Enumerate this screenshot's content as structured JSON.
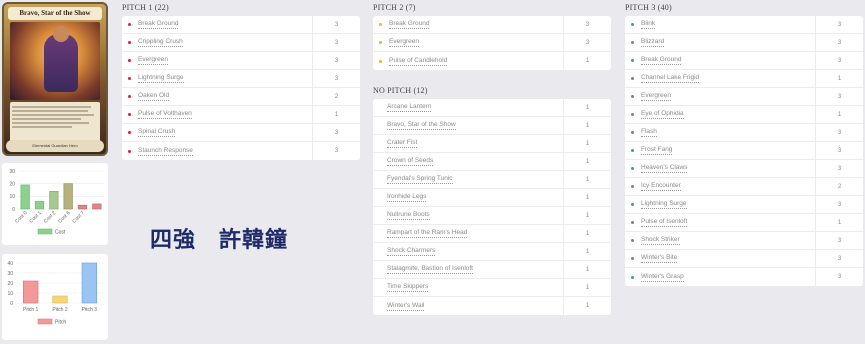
{
  "hero_card": {
    "name": "Bravo, Star of the Show",
    "type_line": "Elemental Guardian Hero",
    "intellect": "4",
    "life": "40"
  },
  "cost_chart_data": {
    "type": "bar",
    "categories": [
      "Cost 0",
      "Cost 1",
      "Cost 2",
      "Cost 6",
      "Cost 7"
    ],
    "values": [
      19,
      6,
      14,
      20,
      3
    ],
    "extra_value": 4,
    "yticks": [
      "0",
      "10",
      "20",
      "30"
    ],
    "ylim": [
      0,
      30
    ],
    "legend": "Cost",
    "colors": {
      "fill": "#8ed18e",
      "stroke": "#5fb85f"
    }
  },
  "chart_data": {
    "type": "bar",
    "categories": [
      "Pitch 1",
      "Pitch 2",
      "Pitch 3"
    ],
    "values": [
      22,
      7,
      40
    ],
    "ylim": [
      0,
      40
    ],
    "yticks": [
      "0",
      "10",
      "20",
      "30",
      "40"
    ],
    "legend": "Pitch",
    "colors": [
      "#f29a9a",
      "#f5d478",
      "#9cc4f2"
    ]
  },
  "pitch1": {
    "title": "PITCH 1 (22)",
    "dot_color": "#d9262b",
    "cards": [
      {
        "name": "Break Ground",
        "qty": "3"
      },
      {
        "name": "Crippling Crush",
        "qty": "3"
      },
      {
        "name": "Evergreen",
        "qty": "3"
      },
      {
        "name": "Lightning Surge",
        "qty": "3"
      },
      {
        "name": "Oaken Old",
        "qty": "2"
      },
      {
        "name": "Pulse of Volthaven",
        "qty": "1"
      },
      {
        "name": "Spinal Crush",
        "qty": "3"
      },
      {
        "name": "Staunch Response",
        "qty": "3"
      }
    ]
  },
  "pitch2": {
    "title": "PITCH 2 (7)",
    "dot_color": "#e8b820",
    "cards": [
      {
        "name": "Break Ground",
        "qty": "3"
      },
      {
        "name": "Evergreen",
        "qty": "3"
      },
      {
        "name": "Pulse of Candlehold",
        "qty": "1"
      }
    ]
  },
  "nopitch": {
    "title": "NO PITCH (12)",
    "cards": [
      {
        "name": "Arcane Lantern",
        "qty": "1"
      },
      {
        "name": "Bravo, Star of the Show",
        "qty": "1"
      },
      {
        "name": "Crater Fist",
        "qty": "1"
      },
      {
        "name": "Crown of Seeds",
        "qty": "1"
      },
      {
        "name": "Fyendal's Spring Tunic",
        "qty": "1"
      },
      {
        "name": "Ironhide Legs",
        "qty": "1"
      },
      {
        "name": "Nullrune Boots",
        "qty": "1"
      },
      {
        "name": "Rampart of the Ram's Head",
        "qty": "1"
      },
      {
        "name": "Shock Charmers",
        "qty": "1"
      },
      {
        "name": "Stalagmite, Bastion of Isenloft",
        "qty": "1"
      },
      {
        "name": "Time Skippers",
        "qty": "1"
      },
      {
        "name": "Winter's Wail",
        "qty": "1"
      }
    ]
  },
  "pitch3": {
    "title": "PITCH 3 (40)",
    "dot_color": "#3f8fd9",
    "cards": [
      {
        "name": "Blink",
        "qty": "3"
      },
      {
        "name": "Blizzard",
        "qty": "3"
      },
      {
        "name": "Break Ground",
        "qty": "3"
      },
      {
        "name": "Channel Lake Frigid",
        "qty": "1"
      },
      {
        "name": "Evergreen",
        "qty": "3"
      },
      {
        "name": "Eye of Ophidia",
        "qty": "1"
      },
      {
        "name": "Flash",
        "qty": "3"
      },
      {
        "name": "Frost Fang",
        "qty": "3"
      },
      {
        "name": "Heaven's Claws",
        "qty": "3"
      },
      {
        "name": "Icy Encounter",
        "qty": "2"
      },
      {
        "name": "Lightning Surge",
        "qty": "3"
      },
      {
        "name": "Pulse of Isenloft",
        "qty": "1"
      },
      {
        "name": "Shock Striker",
        "qty": "3"
      },
      {
        "name": "Winter's Bite",
        "qty": "3"
      },
      {
        "name": "Winter's Grasp",
        "qty": "3"
      }
    ]
  },
  "overlay_text": "四強　許韓鐘"
}
